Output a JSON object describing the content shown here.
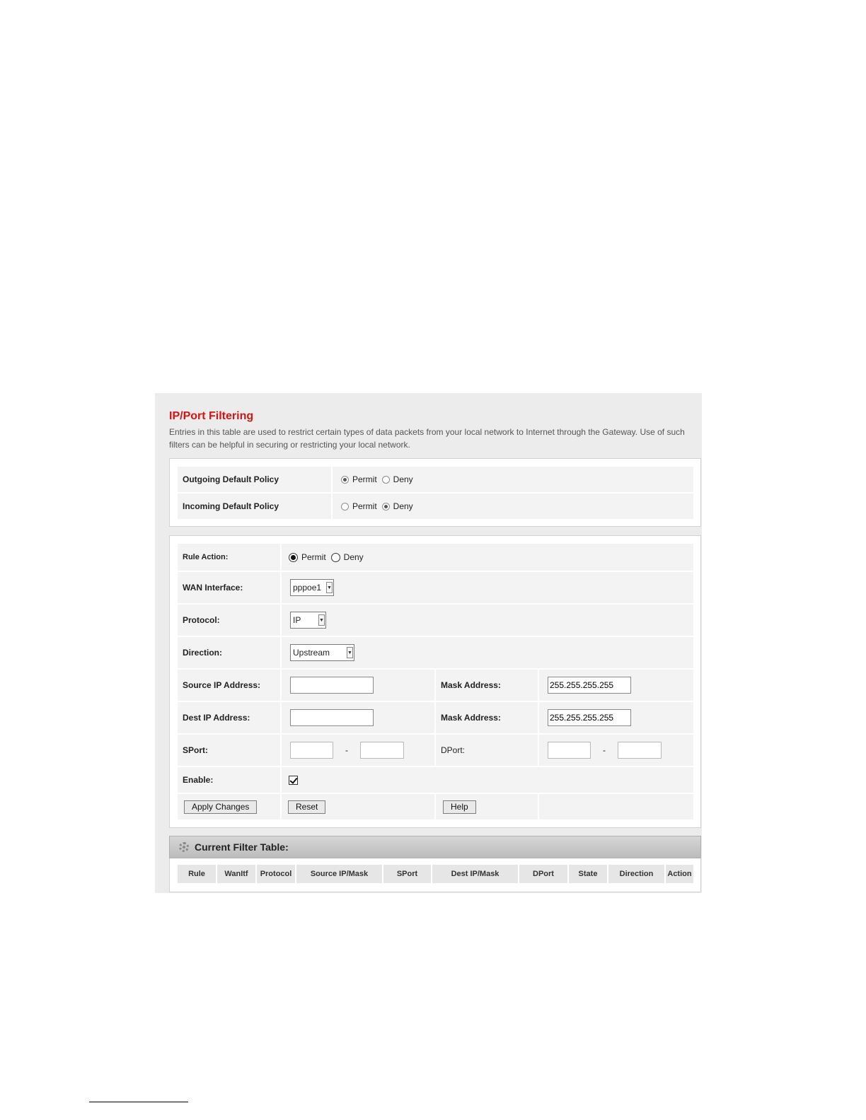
{
  "page": {
    "title": "IP/Port Filtering",
    "description": "Entries in this table are used to restrict certain types of data packets from your local network to Internet through the Gateway. Use of such filters can be helpful in securing or restricting your local network."
  },
  "default_policy": {
    "outgoing_label": "Outgoing Default Policy",
    "incoming_label": "Incoming Default Policy",
    "permit_label": "Permit",
    "deny_label": "Deny",
    "outgoing_selected": "Permit",
    "incoming_selected": "Deny"
  },
  "rule_form": {
    "rule_action_label": "Rule Action:",
    "rule_action_selected": "Permit",
    "permit_label": "Permit",
    "deny_label": "Deny",
    "wan_interface_label": "WAN Interface:",
    "wan_interface_value": "pppoe1",
    "protocol_label": "Protocol:",
    "protocol_value": "IP",
    "direction_label": "Direction:",
    "direction_value": "Upstream",
    "source_ip_label": "Source IP Address:",
    "source_ip_value": "",
    "source_mask_label": "Mask Address:",
    "source_mask_value": "255.255.255.255",
    "dest_ip_label": "Dest IP Address:",
    "dest_ip_value": "",
    "dest_mask_label": "Mask Address:",
    "dest_mask_value": "255.255.255.255",
    "sport_label": "SPort:",
    "dport_label": "DPort:",
    "range_separator": "-",
    "enable_label": "Enable:",
    "enable_checked": true,
    "apply_label": "Apply Changes",
    "reset_label": "Reset",
    "help_label": "Help"
  },
  "filter_table": {
    "title": "Current Filter Table:",
    "columns": [
      "Rule",
      "WanItf",
      "Protocol",
      "Source IP/Mask",
      "SPort",
      "Dest IP/Mask",
      "DPort",
      "State",
      "Direction",
      "Action"
    ],
    "rows": []
  },
  "colors": {
    "title": "#d41414",
    "panel_background": "#ececec",
    "row_background": "#f3f3f3"
  }
}
